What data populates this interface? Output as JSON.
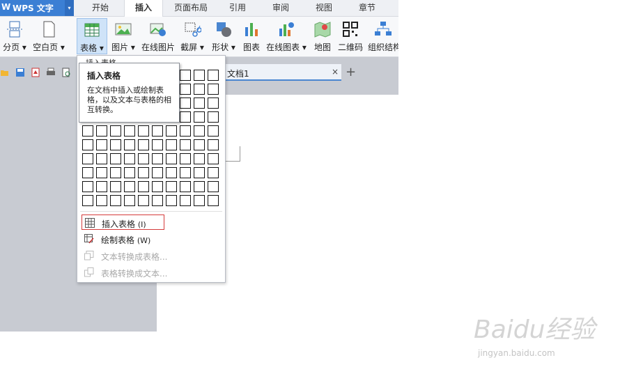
{
  "app": {
    "logo": "W",
    "title": "WPS 文字",
    "title_arrow": "▾"
  },
  "menu_tabs": [
    "开始",
    "插入",
    "页面布局",
    "引用",
    "审阅",
    "视图",
    "章节"
  ],
  "ribbon": {
    "page_break": "分页 ▾",
    "blank_page": "空白页 ▾",
    "table": "表格 ▾",
    "picture": "图片 ▾",
    "online_picture": "在线图片",
    "screenshot": "截屏 ▾",
    "shapes": "形状 ▾",
    "chart": "图表",
    "online_chart": "在线图表 ▾",
    "map": "地图",
    "qrcode": "二维码",
    "org_chart": "组织结构"
  },
  "document": {
    "tab_label": "文档1",
    "close": "×",
    "new_tab": "+"
  },
  "dropdown": {
    "header": "插入表格",
    "grid_rows": 10,
    "grid_cols": 10,
    "items": [
      {
        "label": "插入表格",
        "key": "(I)",
        "enabled": true,
        "highlighted": true
      },
      {
        "label": "绘制表格",
        "key": "(W)",
        "enabled": true,
        "highlighted": false
      },
      {
        "label": "文本转换成表格...",
        "key": "",
        "enabled": false,
        "highlighted": false
      },
      {
        "label": "表格转换成文本...",
        "key": "",
        "enabled": false,
        "highlighted": false
      }
    ]
  },
  "tooltip": {
    "title": "插入表格",
    "body": "在文档中插入或绘制表格，以及文本与表格的相互转换。"
  },
  "watermark": {
    "brand": "Baidu经验",
    "url": "jingyan.baidu.com"
  },
  "colors": {
    "accent": "#3b7fd4",
    "ribbon_selected": "#cfe3f8",
    "highlight_border": "#d43a3a"
  }
}
